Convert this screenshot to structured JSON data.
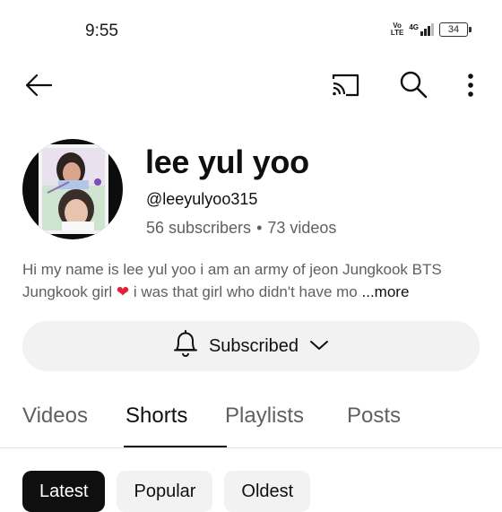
{
  "status_bar": {
    "time": "9:55",
    "volte_top": "Vo",
    "volte_bottom": "LTE",
    "network": "4G",
    "battery": "34"
  },
  "app_bar": {
    "icons": [
      "back-arrow-icon",
      "cast-icon",
      "search-icon",
      "more-vert-icon"
    ]
  },
  "channel": {
    "name": "lee yul yoo",
    "handle": "@leeyulyoo315",
    "subscribers": "56 subscribers",
    "separator": "•",
    "videos": "73 videos",
    "description_line1": "Hi my name is lee yul yoo i am an army of jeon Jungkook BTS",
    "description_line2_start": "Jungkook girl",
    "description_line2_end": "i was that girl who didn't have mo",
    "description_more": "...more"
  },
  "subscribe": {
    "label": "Subscribed",
    "icon": "bell-icon"
  },
  "tabs": [
    {
      "label": "Videos",
      "active": false
    },
    {
      "label": "Shorts",
      "active": true
    },
    {
      "label": "Playlists",
      "active": false
    },
    {
      "label": "Posts",
      "active": false
    }
  ],
  "chips": [
    {
      "label": "Latest",
      "active": true
    },
    {
      "label": "Popular",
      "active": false
    },
    {
      "label": "Oldest",
      "active": false
    }
  ],
  "colors": {
    "text_primary": "#0f0f0f",
    "text_secondary": "#606060",
    "chip_bg": "#f2f2f2",
    "heart": "#e0213a"
  }
}
